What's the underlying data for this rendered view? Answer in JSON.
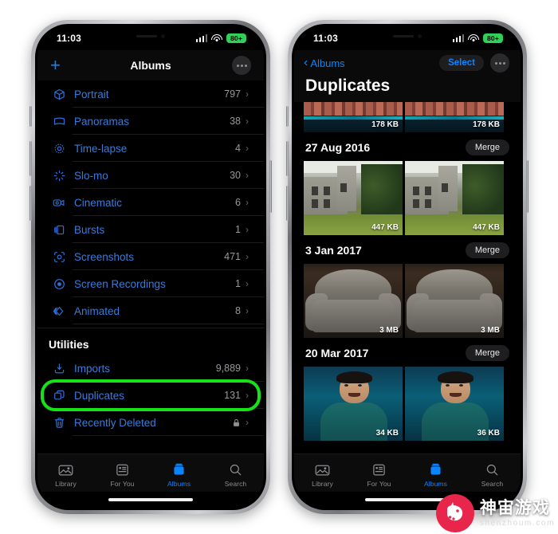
{
  "watermark": {
    "cn_text": "神宙游戏",
    "en_text": "shenzhoum.com",
    "logo_icon": "unicorn-logo-icon",
    "brand_color": "#e8254a"
  },
  "phone_left": {
    "status_bar": {
      "time": "11:03",
      "cellular_icon": "cellular-bars-icon",
      "wifi_icon": "wifi-icon",
      "battery_label": "80+",
      "battery_color": "#30d158"
    },
    "nav_bar": {
      "add_label": "+",
      "add_icon": "plus-icon",
      "title": "Albums",
      "more_icon": "ellipsis-icon"
    },
    "media_types": [
      {
        "label": "Portrait",
        "count": "797",
        "icon": "cube-icon",
        "chevron": "›"
      },
      {
        "label": "Panoramas",
        "count": "38",
        "icon": "panorama-icon",
        "chevron": "›"
      },
      {
        "label": "Time-lapse",
        "count": "4",
        "icon": "timelapse-icon",
        "chevron": "›"
      },
      {
        "label": "Slo-mo",
        "count": "30",
        "icon": "slomo-icon",
        "chevron": "›"
      },
      {
        "label": "Cinematic",
        "count": "6",
        "icon": "cinematic-video-icon",
        "chevron": "›"
      },
      {
        "label": "Bursts",
        "count": "1",
        "icon": "bursts-icon",
        "chevron": "›"
      },
      {
        "label": "Screenshots",
        "count": "471",
        "icon": "screenshot-icon",
        "chevron": "›"
      },
      {
        "label": "Screen Recordings",
        "count": "1",
        "icon": "record-circle-icon",
        "chevron": "›"
      },
      {
        "label": "Animated",
        "count": "8",
        "icon": "animated-icon",
        "chevron": "›"
      }
    ],
    "utilities_header": "Utilities",
    "utilities": [
      {
        "label": "Imports",
        "count": "9,889",
        "icon": "import-icon",
        "chevron": "›",
        "locked": false
      },
      {
        "label": "Duplicates",
        "count": "131",
        "icon": "duplicate-icon",
        "chevron": "›",
        "locked": false,
        "highlighted": true
      },
      {
        "label": "Recently Deleted",
        "count": "",
        "icon": "trash-icon",
        "chevron": "›",
        "locked": true
      }
    ],
    "highlight_color": "#16e316",
    "tab_bar": [
      {
        "label": "Library",
        "icon": "library-icon",
        "active": false
      },
      {
        "label": "For You",
        "icon": "for-you-icon",
        "active": false
      },
      {
        "label": "Albums",
        "icon": "albums-icon",
        "active": true
      },
      {
        "label": "Search",
        "icon": "search-icon",
        "active": false
      }
    ]
  },
  "phone_right": {
    "status_bar": {
      "time": "11:03",
      "cellular_icon": "cellular-bars-icon",
      "wifi_icon": "wifi-icon",
      "battery_label": "80+",
      "battery_color": "#30d158"
    },
    "nav_bar": {
      "back_label": "Albums",
      "back_icon": "chevron-left-icon",
      "select_label": "Select",
      "more_icon": "ellipsis-icon"
    },
    "page_title": "Duplicates",
    "groups": [
      {
        "date": "",
        "merge_label": "",
        "partial": true,
        "art": "venice",
        "photos": [
          {
            "size": "178 KB"
          },
          {
            "size": "178 KB"
          }
        ]
      },
      {
        "date": "27 Aug 2016",
        "merge_label": "Merge",
        "partial": false,
        "art": "castle",
        "photos": [
          {
            "size": "447 KB"
          },
          {
            "size": "447 KB"
          }
        ]
      },
      {
        "date": "3 Jan 2017",
        "merge_label": "Merge",
        "partial": false,
        "art": "chair",
        "photos": [
          {
            "size": "3 MB"
          },
          {
            "size": "3 MB"
          }
        ]
      },
      {
        "date": "20 Mar 2017",
        "merge_label": "Merge",
        "partial": false,
        "art": "person",
        "photos": [
          {
            "size": "34 KB"
          },
          {
            "size": "36 KB"
          }
        ]
      }
    ],
    "tab_bar": [
      {
        "label": "Library",
        "icon": "library-icon",
        "active": false
      },
      {
        "label": "For You",
        "icon": "for-you-icon",
        "active": false
      },
      {
        "label": "Albums",
        "icon": "albums-icon",
        "active": true
      },
      {
        "label": "Search",
        "icon": "search-icon",
        "active": false
      }
    ]
  }
}
